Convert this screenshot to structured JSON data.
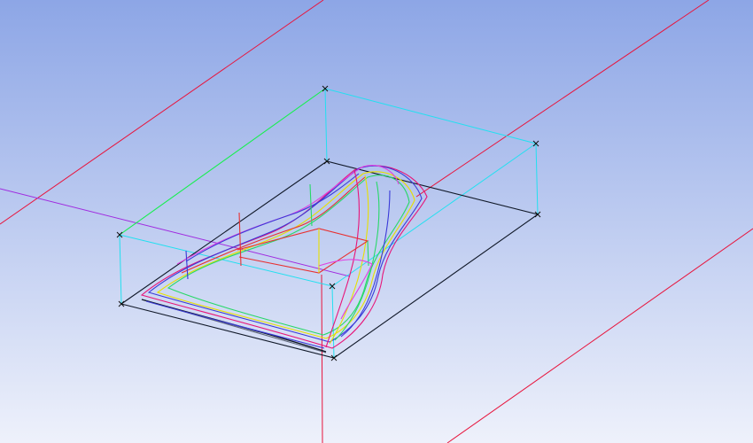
{
  "viewport": {
    "background_top": "#8da6e6",
    "background_bottom": "#eef1fb"
  },
  "colors": {
    "x_axis": "#e8143c",
    "y_axis": "#a02ce0",
    "z_axis": "#e8143c",
    "stock_box": "#22e0f0",
    "stock_edge_highlight": "#22ee44",
    "part_base": "#101828",
    "part_curves": [
      "#e81478",
      "#3a3ad8",
      "#e8e000",
      "#28d868",
      "#e040e0",
      "#e83030"
    ],
    "vertex_marker": "#101010"
  }
}
